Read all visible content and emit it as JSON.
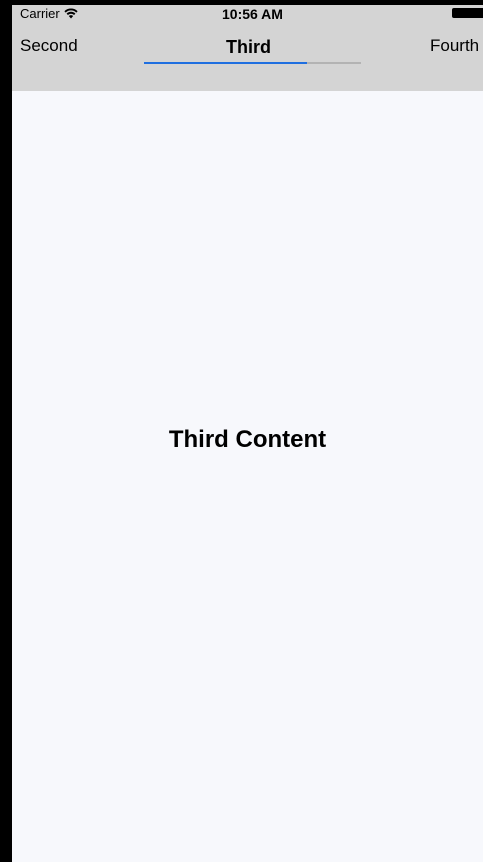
{
  "status_bar": {
    "carrier": "Carrier",
    "time": "10:56 AM",
    "icons": [
      "wifi-icon",
      "battery-icon"
    ]
  },
  "tabs": {
    "items": [
      {
        "label": "Second",
        "selected": false
      },
      {
        "label": "Third",
        "selected": true
      },
      {
        "label": "Fourth",
        "selected": false
      }
    ],
    "indicator_progress": 0.75,
    "indicator_color": "#1f6fe0"
  },
  "content": {
    "title": "Third Content"
  },
  "colors": {
    "header_background": "#d4d4d4",
    "content_background": "#f7f8fc"
  }
}
